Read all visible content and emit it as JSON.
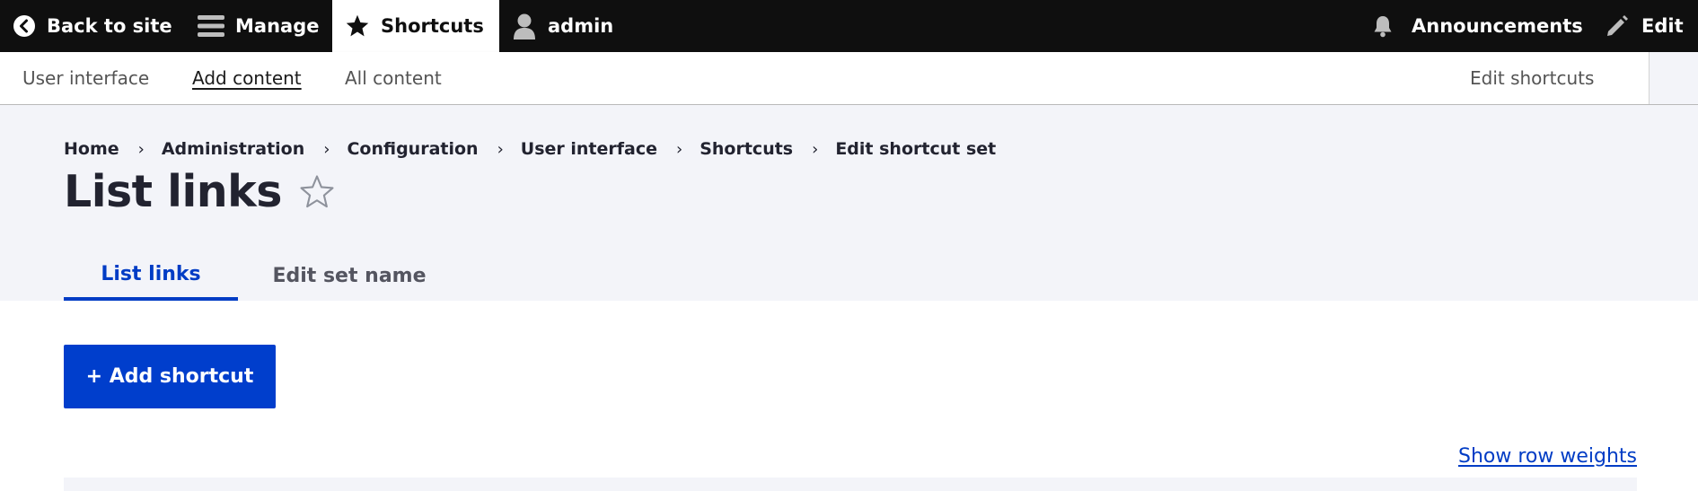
{
  "toolbar": {
    "back_label": "Back to site",
    "manage_label": "Manage",
    "shortcuts_label": "Shortcuts",
    "user_label": "admin",
    "announcements_label": "Announcements",
    "edit_label": "Edit",
    "icons": [
      "chevron-left-circle-icon",
      "hamburger-icon",
      "star-icon",
      "user-icon",
      "bell-icon",
      "pencil-icon"
    ]
  },
  "tray": {
    "links": [
      "User interface",
      "Add content",
      "All content"
    ],
    "active_link": "Add content",
    "edit_shortcuts_label": "Edit shortcuts"
  },
  "breadcrumb": [
    "Home",
    "Administration",
    "Configuration",
    "User interface",
    "Shortcuts",
    "Edit shortcut set"
  ],
  "breadcrumb_separator": "›",
  "page": {
    "title": "List links",
    "tabs": [
      "List links",
      "Edit set name"
    ],
    "active_tab": "List links"
  },
  "actions": {
    "add_shortcut_label": "+ Add shortcut",
    "show_row_weights_label": "Show row weights"
  },
  "colors": {
    "toolbar_bg": "#0f0f0f",
    "header_bg": "#f3f4f9",
    "accent": "#003ecc",
    "link": "#003cc5"
  }
}
